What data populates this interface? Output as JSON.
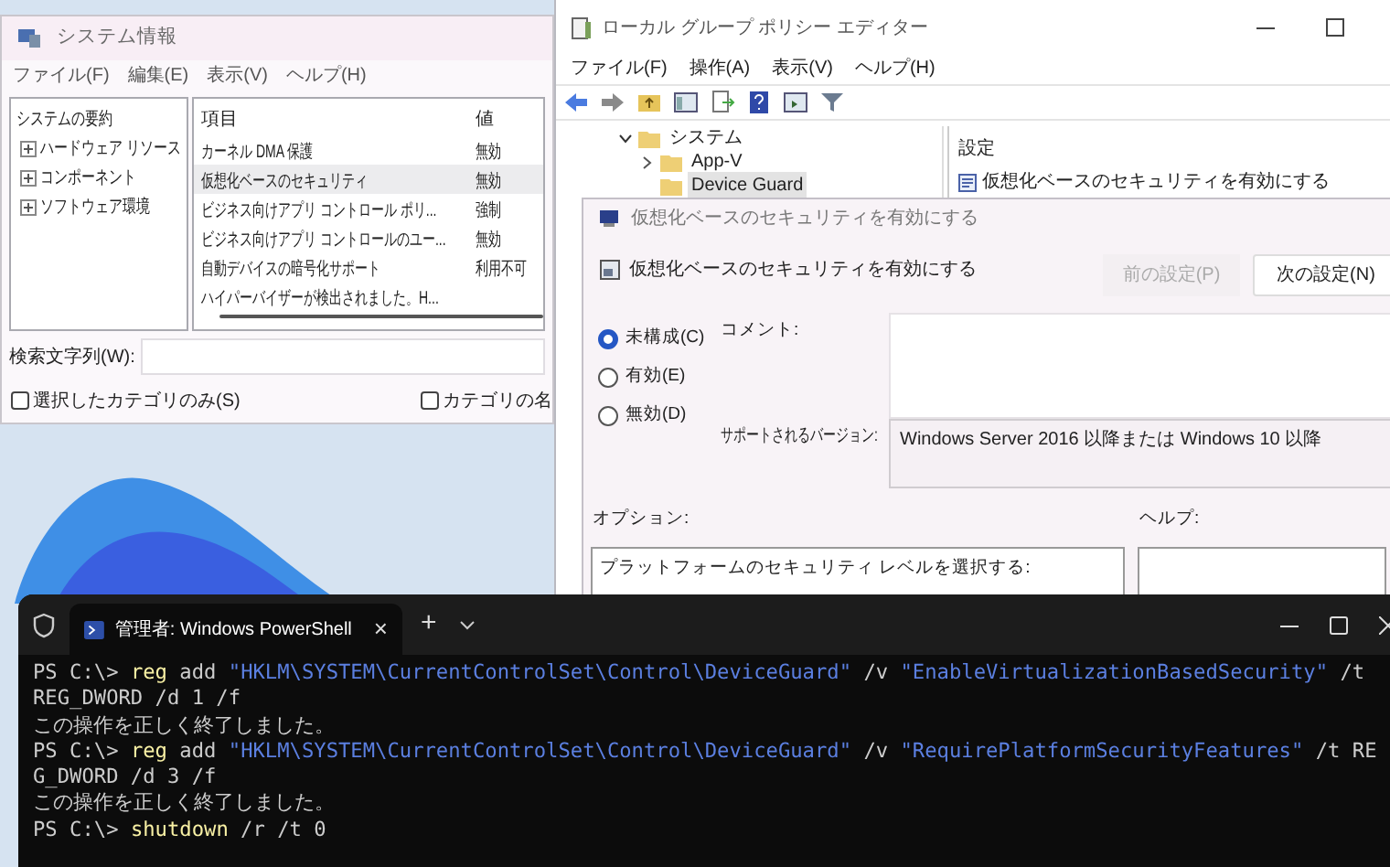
{
  "system_info": {
    "title": "システム情報",
    "menu": [
      "ファイル(F)",
      "編集(E)",
      "表示(V)",
      "ヘルプ(H)"
    ],
    "tree": [
      {
        "label": "システムの要約",
        "children": [
          {
            "label": "ハードウェア リソース",
            "expanded": false
          },
          {
            "label": "コンポーネント",
            "expanded": false
          },
          {
            "label": "ソフトウェア環境",
            "expanded": false
          }
        ]
      }
    ],
    "table": {
      "columns": [
        "項目",
        "値"
      ],
      "rows": [
        {
          "cells": [
            "カーネル DMA 保護",
            "無効"
          ],
          "selected": false
        },
        {
          "cells": [
            "仮想化ベースのセキュリティ",
            "無効"
          ],
          "selected": true
        },
        {
          "cells": [
            "ビジネス向けアプリ コントロール ポリ...",
            "強制"
          ],
          "selected": false
        },
        {
          "cells": [
            "ビジネス向けアプリ コントロールのユー...",
            "無効"
          ],
          "selected": false
        },
        {
          "cells": [
            "自動デバイスの暗号化サポート",
            "利用不可"
          ],
          "selected": false
        },
        {
          "cells": [
            "ハイパーバイザーが検出されました。H..."
          ],
          "selected": false
        }
      ]
    },
    "search": {
      "label": "検索文字列(W):"
    },
    "checkboxes": [
      {
        "label": "選択したカテゴリのみ(S)",
        "checked": false
      },
      {
        "label": "カテゴリの名",
        "checked": false
      }
    ]
  },
  "policy_editor": {
    "title": "ローカル グループ ポリシー エディター",
    "menu": [
      "ファイル(F)",
      "操作(A)",
      "表示(V)",
      "ヘルプ(H)"
    ],
    "tree": [
      {
        "label": "システム",
        "expanded": true,
        "selected": false,
        "children": [
          {
            "label": "App-V",
            "expanded": false,
            "selected": false
          },
          {
            "label": "Device Guard",
            "selected": true
          }
        ]
      }
    ],
    "settings": {
      "header": "設定",
      "items": [
        "仮想化ベースのセキュリティを有効にする"
      ]
    }
  },
  "dialog": {
    "title": "仮想化ベースのセキュリティを有効にする",
    "heading": "仮想化ベースのセキュリティを有効にする",
    "buttons": [
      {
        "label": "前の設定(P)",
        "disabled": true
      },
      {
        "label": "次の設定(N)",
        "disabled": false
      }
    ],
    "radios": [
      {
        "label": "未構成(C)",
        "selected": true
      },
      {
        "label": "有効(E)",
        "selected": false
      },
      {
        "label": "無効(D)",
        "selected": false
      }
    ],
    "comment_label": "コメント:",
    "supported_label": "サポートされるバージョン:",
    "supported_value": "Windows Server 2016 以降または Windows 10 以降",
    "options_label": "オプション:",
    "help_label": "ヘルプ:",
    "options_text": "プラットフォームのセキュリティ レベルを選択する:"
  },
  "terminal": {
    "tab_title": "管理者: Windows PowerShell",
    "tab_close": "×",
    "new_tab": "+",
    "lines": [
      [
        {
          "kind": "plain",
          "text": "PS C:\\> "
        },
        {
          "kind": "command",
          "text": "reg"
        },
        {
          "kind": "plain",
          "text": " add "
        },
        {
          "kind": "string",
          "text": "\"HKLM\\SYSTEM\\CurrentControlSet\\Control\\DeviceGuard\""
        },
        {
          "kind": "plain",
          "text": " /v "
        },
        {
          "kind": "string",
          "text": "\"EnableVirtualizationBasedSecurity\""
        },
        {
          "kind": "plain",
          "text": " /t"
        }
      ],
      [
        {
          "kind": "plain",
          "text": "REG_DWORD /d 1 /f"
        }
      ],
      [
        {
          "kind": "plain",
          "text": "この操作を正しく終了しました。"
        }
      ],
      [
        {
          "kind": "plain",
          "text": "PS C:\\> "
        },
        {
          "kind": "command",
          "text": "reg"
        },
        {
          "kind": "plain",
          "text": " add "
        },
        {
          "kind": "string",
          "text": "\"HKLM\\SYSTEM\\CurrentControlSet\\Control\\DeviceGuard\""
        },
        {
          "kind": "plain",
          "text": " /v "
        },
        {
          "kind": "string",
          "text": "\"RequirePlatformSecurityFeatures\""
        },
        {
          "kind": "plain",
          "text": " /t RE"
        }
      ],
      [
        {
          "kind": "plain",
          "text": "G_DWORD /d 3 /f"
        }
      ],
      [
        {
          "kind": "plain",
          "text": "この操作を正しく終了しました。"
        }
      ],
      [
        {
          "kind": "plain",
          "text": "PS C:\\> "
        },
        {
          "kind": "command",
          "text": "shutdown"
        },
        {
          "kind": "plain",
          "text": " /r /t 0"
        }
      ]
    ]
  }
}
